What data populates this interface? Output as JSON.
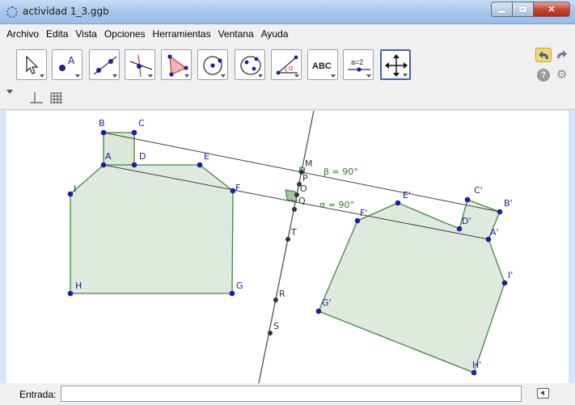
{
  "window": {
    "title": "actividad 1_3.ggb"
  },
  "menu": [
    "Archivo",
    "Edita",
    "Vista",
    "Opciones",
    "Herramientas",
    "Ventana",
    "Ayuda"
  ],
  "toolbar": {
    "tools": [
      {
        "name": "move-tool-button",
        "icon": "pointer-arrow-icon"
      },
      {
        "name": "new-point-tool-button",
        "icon": "point-icon"
      },
      {
        "name": "line-tool-button",
        "icon": "line-through-points-icon"
      },
      {
        "name": "perpendicular-line-tool-button",
        "icon": "perpendicular-line-icon"
      },
      {
        "name": "polygon-tool-button",
        "icon": "polygon-icon"
      },
      {
        "name": "circle-tool-button",
        "icon": "circle-center-point-icon"
      },
      {
        "name": "conic-tool-button",
        "icon": "ellipse-icon"
      },
      {
        "name": "angle-tool-button",
        "icon": "angle-icon"
      },
      {
        "name": "text-tool-button",
        "icon": "text-icon",
        "label": "ABC"
      },
      {
        "name": "slider-tool-button",
        "icon": "slider-icon",
        "label": "a=2"
      },
      {
        "name": "move-view-tool-button",
        "icon": "move-graphics-view-icon"
      }
    ],
    "active_tool": "move-view-tool-button"
  },
  "graphics": {
    "points": [
      {
        "label": "B"
      },
      {
        "label": "C"
      },
      {
        "label": "A"
      },
      {
        "label": "D"
      },
      {
        "label": "E"
      },
      {
        "label": "I"
      },
      {
        "label": "F"
      },
      {
        "label": "H"
      },
      {
        "label": "G"
      },
      {
        "label": "M"
      },
      {
        "label": "P"
      },
      {
        "label": "O"
      },
      {
        "label": "Q"
      },
      {
        "label": "T"
      },
      {
        "label": "R"
      },
      {
        "label": "S"
      },
      {
        "label": "E'"
      },
      {
        "label": "F'"
      },
      {
        "label": "C'"
      },
      {
        "label": "B'"
      },
      {
        "label": "D'"
      },
      {
        "label": "A'"
      },
      {
        "label": "I'"
      },
      {
        "label": "G'"
      },
      {
        "label": "H'"
      }
    ],
    "angles": [
      {
        "label": "β = 90°"
      },
      {
        "label": "α = 90°"
      }
    ],
    "colors": {
      "polygon_fill": "#d9e8d9",
      "polygon_stroke": "#3c8a3c",
      "point": "#1d1da5",
      "line": "#444444",
      "angle": "#2a7a2a"
    }
  },
  "input_bar": {
    "label": "Entrada:",
    "value": ""
  }
}
